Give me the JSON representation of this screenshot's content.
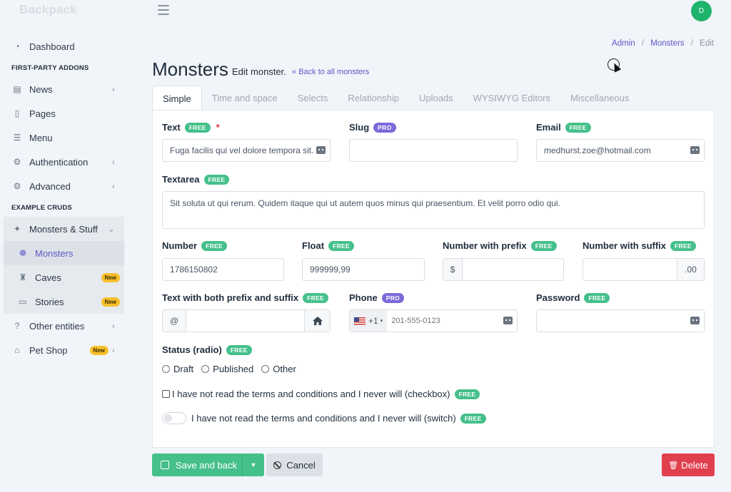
{
  "app": {
    "brand": "Backpack",
    "avatar_initial": "D"
  },
  "sidebar": {
    "items": [
      {
        "label": "Dashboard",
        "icon": "gauge-icon"
      }
    ],
    "header_first_party": "FIRST-PARTY ADDONS",
    "first_party": [
      {
        "label": "News",
        "icon": "newspaper-icon",
        "chevron": true
      },
      {
        "label": "Pages",
        "icon": "file-icon"
      },
      {
        "label": "Menu",
        "icon": "list-icon"
      },
      {
        "label": "Authentication",
        "icon": "users-icon",
        "chevron": true
      },
      {
        "label": "Advanced",
        "icon": "cogs-icon",
        "chevron": true
      }
    ],
    "header_example": "EXAMPLE CRUDS",
    "group_label": "Monsters & Stuff",
    "group_children": [
      {
        "label": "Monsters",
        "icon": "spider-icon",
        "active": true
      },
      {
        "label": "Caves",
        "icon": "castle-icon",
        "badge": "New"
      },
      {
        "label": "Stories",
        "icon": "book-icon",
        "badge": "New"
      }
    ],
    "other_entities": "Other entities",
    "pet_shop": "Pet Shop",
    "pet_shop_badge": "New"
  },
  "breadcrumb": {
    "admin": "Admin",
    "monsters": "Monsters",
    "edit": "Edit",
    "sep": "/"
  },
  "header": {
    "title": "Monsters",
    "subtitle": "Edit monster.",
    "back_link": "Back to all monsters"
  },
  "tabs": [
    "Simple",
    "Time and space",
    "Selects",
    "Relationship",
    "Uploads",
    "WYSIWYG Editors",
    "Miscellaneous"
  ],
  "badges": {
    "free": "FREE",
    "pro": "PRO"
  },
  "form": {
    "text": {
      "label": "Text",
      "required": "*",
      "value": "Fuga facilis qui vel dolore tempora sit."
    },
    "slug": {
      "label": "Slug",
      "value": ""
    },
    "email": {
      "label": "Email",
      "value": "medhurst.zoe@hotmail.com"
    },
    "textarea": {
      "label": "Textarea",
      "value": "Sit soluta ut qui rerum. Quidem itaque qui ut autem quos minus qui praesentium. Et velit porro odio qui."
    },
    "number": {
      "label": "Number",
      "value": "1786150802"
    },
    "float": {
      "label": "Float",
      "value": "999999,99"
    },
    "number_prefix": {
      "label": "Number with prefix",
      "prefix": "$",
      "value": ""
    },
    "number_suffix": {
      "label": "Number with suffix",
      "suffix": ".00",
      "value": ""
    },
    "prefix_suffix": {
      "label": "Text with both prefix and suffix",
      "prefix": "@",
      "value": ""
    },
    "phone": {
      "label": "Phone",
      "country_code": "+1",
      "placeholder": "201-555-0123"
    },
    "password": {
      "label": "Password",
      "value": ""
    },
    "status": {
      "label": "Status (radio)",
      "options": [
        "Draft",
        "Published",
        "Other"
      ]
    },
    "checkbox_label": "I have not read the terms and conditions and I never will (checkbox)",
    "switch_label": "I have not read the terms and conditions and I never will (switch)"
  },
  "buttons": {
    "save": "Save and back",
    "cancel": "Cancel",
    "delete": "Delete"
  }
}
